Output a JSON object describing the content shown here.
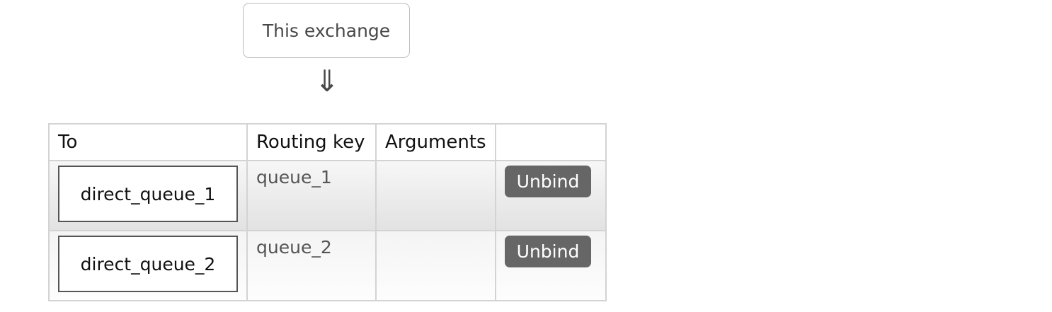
{
  "source": {
    "label": "This exchange",
    "arrow": "⇓"
  },
  "bindings_table": {
    "headers": {
      "to": "To",
      "routing_key": "Routing key",
      "arguments": "Arguments",
      "actions": ""
    },
    "rows": [
      {
        "to": "direct_queue_1",
        "routing_key": "queue_1",
        "arguments": "",
        "action_label": "Unbind"
      },
      {
        "to": "direct_queue_2",
        "routing_key": "queue_2",
        "arguments": "",
        "action_label": "Unbind"
      }
    ]
  },
  "colors": {
    "button_bg": "#666666",
    "border": "#d3d3d3"
  }
}
